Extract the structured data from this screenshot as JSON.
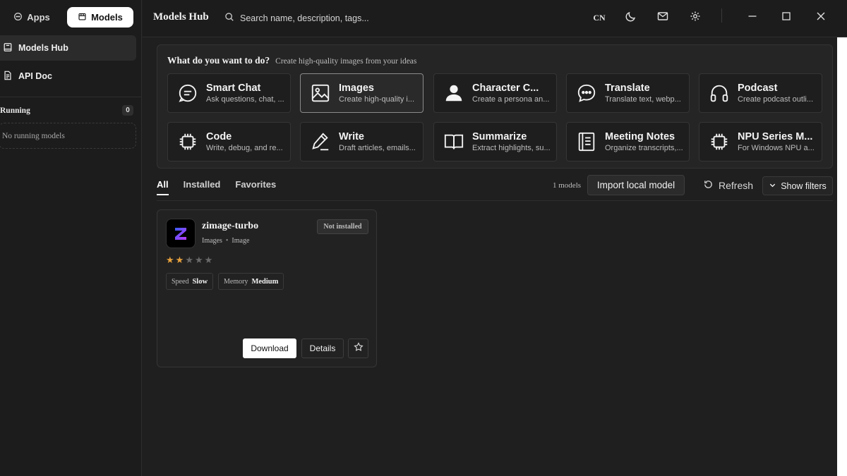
{
  "sidebar": {
    "segment": {
      "apps_label": "Apps",
      "models_label": "Models"
    },
    "nav": [
      {
        "label": "Models Hub",
        "icon": "box-icon"
      },
      {
        "label": "API Doc",
        "icon": "document-icon"
      }
    ],
    "running": {
      "label": "Running",
      "count": "0",
      "empty_text": "No running models"
    }
  },
  "header": {
    "title": "Models Hub",
    "search": {
      "placeholder": "Search name, description, tags...",
      "value": ""
    },
    "language": "CN"
  },
  "tasks": {
    "question": "What do you want to do?",
    "subtitle": "Create high-quality images from your ideas",
    "items": [
      {
        "name": "Smart Chat",
        "desc": "Ask questions, chat, ...",
        "icon": "chat-icon"
      },
      {
        "name": "Images",
        "desc": "Create high-quality i...",
        "icon": "image-icon"
      },
      {
        "name": "Character C...",
        "desc": "Create a persona an...",
        "icon": "person-icon"
      },
      {
        "name": "Translate",
        "desc": "Translate text, webp...",
        "icon": "speech-bubble-icon"
      },
      {
        "name": "Podcast",
        "desc": "Create podcast outli...",
        "icon": "headphones-icon"
      },
      {
        "name": "Code",
        "desc": "Write, debug, and re...",
        "icon": "chip-icon"
      },
      {
        "name": "Write",
        "desc": "Draft articles, emails...",
        "icon": "pencil-icon"
      },
      {
        "name": "Summarize",
        "desc": "Extract highlights, su...",
        "icon": "book-icon"
      },
      {
        "name": "Meeting Notes",
        "desc": "Organize transcripts,...",
        "icon": "notes-icon"
      },
      {
        "name": "NPU Series M...",
        "desc": "For Windows NPU a...",
        "icon": "chip-icon"
      }
    ],
    "selected": "Images"
  },
  "tabs": [
    {
      "label": "All",
      "active": true
    },
    {
      "label": "Installed",
      "active": false
    },
    {
      "label": "Favorites",
      "active": false
    }
  ],
  "toolbar": {
    "count_text": "1 models",
    "import_label": "Import local model",
    "refresh_label": "Refresh",
    "filters_label": "Show filters"
  },
  "models": [
    {
      "name": "zimage-turbo",
      "category": "Images",
      "type": "Image",
      "status": "Not installed",
      "rating": 2,
      "rating_max": 5,
      "speed_label": "Speed",
      "speed_value": "Slow",
      "memory_label": "Memory",
      "memory_value": "Medium",
      "download_label": "Download",
      "details_label": "Details"
    }
  ],
  "colors": {
    "background": "#1f1f1f",
    "panel": "#252525",
    "star_on": "#e8a23d",
    "star_off": "#6a6a6a",
    "logo_gradient": [
      "#3b5cff",
      "#c13bff"
    ]
  }
}
